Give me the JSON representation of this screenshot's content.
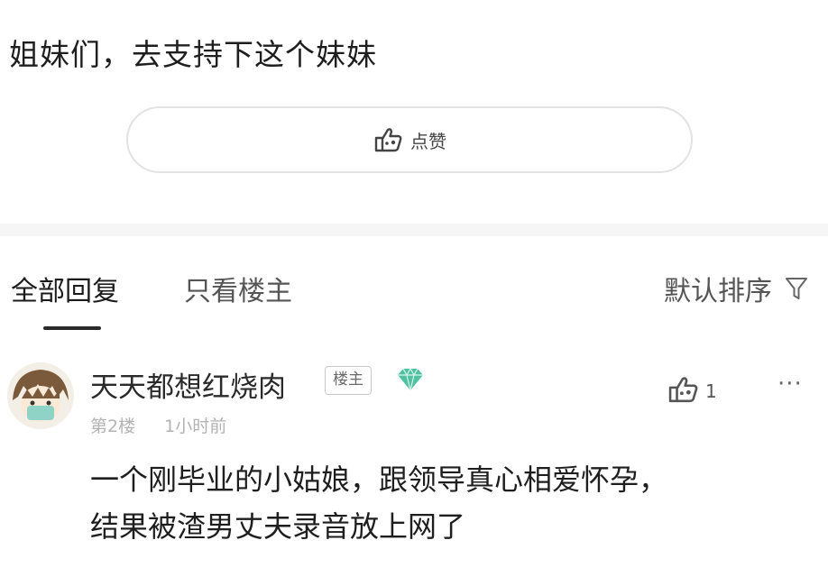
{
  "post": {
    "text": "姐妹们，去支持下这个妹妹",
    "like_button": {
      "icon": "thumbs-up-icon",
      "label": "点赞"
    }
  },
  "tabs": {
    "items": [
      {
        "label": "全部回复",
        "active": true
      },
      {
        "label": "只看楼主",
        "active": false
      }
    ],
    "sort": {
      "label": "默认排序",
      "icon": "filter-funnel-icon"
    }
  },
  "comment": {
    "username": "天天都想红烧肉",
    "badge": "楼主",
    "badge_icon": "diamond-icon",
    "floor": "第2楼",
    "time": "1小时前",
    "like_icon": "thumbs-up-icon",
    "like_count": "1",
    "more_icon": "more-dots-icon",
    "body_lines": [
      "一个刚毕业的小姑娘，跟领导真心相爱怀孕，",
      "结果被渣男丈夫录音放上网了"
    ]
  },
  "colors": {
    "text": "#1e1e1e",
    "muted": "#b3b3b3",
    "border": "#e2e2e2",
    "gem": "#4fc3a1"
  }
}
